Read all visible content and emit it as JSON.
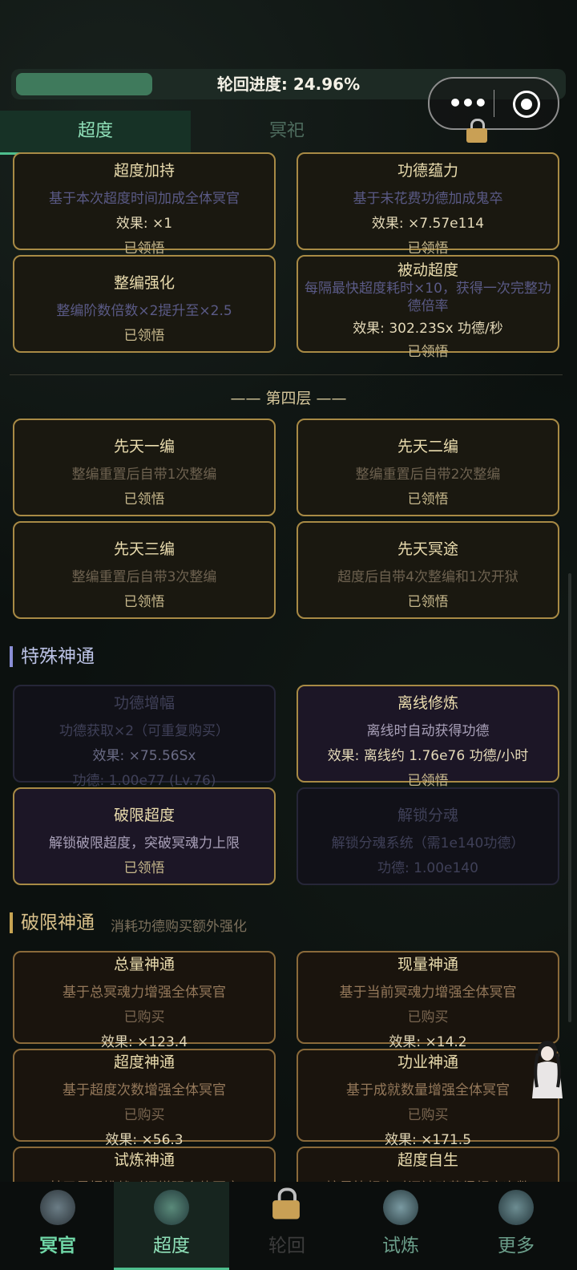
{
  "header": {
    "progress_label": "轮回进度: 24.96%",
    "progress_fraction": 0.2496
  },
  "tabs": [
    {
      "label": "超度",
      "active": true
    },
    {
      "label": "冥祀",
      "active": false
    },
    {
      "label": "",
      "locked": true
    }
  ],
  "cards_top": [
    {
      "title": "超度加持",
      "desc": "基于本次超度时间加成全体冥官",
      "effect": "效果: ×1",
      "status": "已领悟"
    },
    {
      "title": "功德蕴力",
      "desc": "基于未花费功德加成鬼卒",
      "effect": "效果: ×7.57e114",
      "status": "已领悟"
    },
    {
      "title": "整编强化",
      "desc": "整编阶数倍数×2提升至×2.5",
      "status": "已领悟"
    },
    {
      "title": "被动超度",
      "desc": "每隔最快超度耗时×10，获得一次完整功德倍率",
      "effect": "效果: 302.23Sx 功德/秒",
      "status": "已领悟"
    }
  ],
  "layer4": {
    "title": "—— 第四层 ——",
    "cards": [
      {
        "title": "先天一编",
        "desc": "整编重置后自带1次整编",
        "status": "已领悟"
      },
      {
        "title": "先天二编",
        "desc": "整编重置后自带2次整编",
        "status": "已领悟"
      },
      {
        "title": "先天三编",
        "desc": "整编重置后自带3次整编",
        "status": "已领悟"
      },
      {
        "title": "先天冥途",
        "desc": "超度后自带4次整编和1次开狱",
        "status": "已领悟"
      }
    ]
  },
  "special": {
    "title": "特殊神通",
    "cards": [
      {
        "title": "功德增幅",
        "desc": "功德获取×2（可重复购买）",
        "effect": "效果: ×75.56Sx",
        "status": "功德: 1.00e77 (Lv.76)"
      },
      {
        "title": "离线修炼",
        "desc": "离线时自动获得功德",
        "effect": "效果: 离线约 1.76e76 功德/小时",
        "status": "已领悟"
      },
      {
        "title": "破限超度",
        "desc": "解锁破限超度，突破冥魂力上限",
        "status": "已领悟"
      },
      {
        "title": "解锁分魂",
        "desc": "解锁分魂系统（需1e140功德）",
        "status": "功德: 1.00e140"
      }
    ]
  },
  "breakthrough": {
    "title": "破限神通",
    "subtitle": "消耗功德购买额外强化",
    "cards": [
      {
        "title": "总量神通",
        "desc": "基于总冥魂力增强全体冥官",
        "status": "已购买",
        "effect": "效果: ×123.4"
      },
      {
        "title": "现量神通",
        "desc": "基于当前冥魂力增强全体冥官",
        "status": "已购买",
        "effect": "效果: ×14.2"
      },
      {
        "title": "超度神通",
        "desc": "基于超度次数增强全体冥官",
        "status": "已购买",
        "effect": "效果: ×56.3"
      },
      {
        "title": "功业神通",
        "desc": "基于成就数量增强全体冥官",
        "status": "已购买",
        "effect": "效果: ×171.5"
      },
      {
        "title": "试炼神通",
        "desc": "基于最慢挑战时间增强全体冥官"
      },
      {
        "title": "超度自生",
        "desc": "按最快超度时间被动获得超度次数"
      }
    ]
  },
  "nav": [
    {
      "label": "冥官",
      "active": false
    },
    {
      "label": "超度",
      "active": true
    },
    {
      "label": "轮回",
      "locked": true
    },
    {
      "label": "试炼",
      "active": false
    },
    {
      "label": "更多",
      "active": false
    }
  ]
}
